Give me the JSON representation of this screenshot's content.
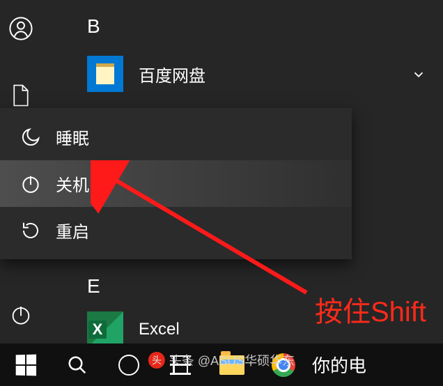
{
  "sections": {
    "b": "B",
    "e": "E"
  },
  "apps": {
    "baidu": "百度网盘",
    "excel": "Excel"
  },
  "power_menu": {
    "sleep": "睡眠",
    "shutdown": "关机",
    "restart": "重启"
  },
  "annotation": {
    "text": "按住Shift"
  },
  "taskbar": {
    "right_text": "你的电"
  },
  "watermark": {
    "logo": "头",
    "text": "头条 @ASUS华硕华东"
  }
}
